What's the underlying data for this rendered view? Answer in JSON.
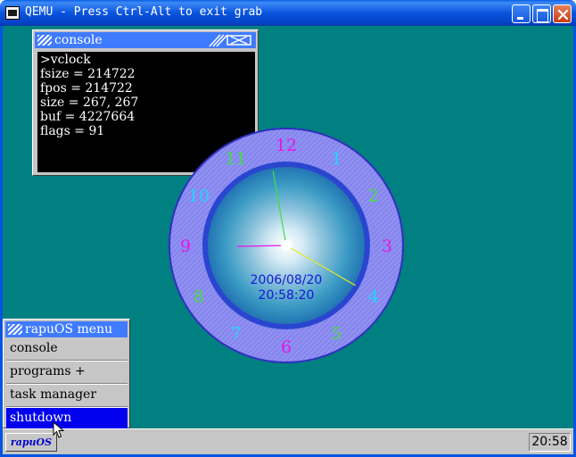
{
  "window": {
    "title": "QEMU - Press Ctrl-Alt to exit grab",
    "icon": "qemu-monitor-icon"
  },
  "console": {
    "title": "console",
    "lines": [
      ">vclock",
      "fsize = 214722",
      "fpos = 214722",
      "size = 267, 267",
      "buf = 4227664",
      "flags = 91"
    ]
  },
  "clock": {
    "numbers": [
      "12",
      "1",
      "2",
      "3",
      "4",
      "5",
      "6",
      "7",
      "8",
      "9",
      "10",
      "11"
    ],
    "date": "2006/08/20",
    "time": "20:58:20",
    "hands": {
      "hour": 20,
      "minute": 58,
      "second": 20
    },
    "colors": {
      "magenta": "#e815e8",
      "cyan": "#22d6ff",
      "green": "#3ee23e",
      "ring": "#8b8bf0",
      "text": "#1717d8"
    }
  },
  "menu": {
    "title": "rapuOS menu",
    "items": [
      {
        "label": "console"
      },
      {
        "label": "programs +"
      },
      {
        "label": "task manager"
      },
      {
        "label": "shutdown",
        "selected": true
      }
    ]
  },
  "taskbar": {
    "start_label": "rapuOS",
    "time": "20:58"
  },
  "colors": {
    "desktop": "#008080",
    "titlebar_blue": "#3f7bff",
    "selection": "#0000ee"
  }
}
